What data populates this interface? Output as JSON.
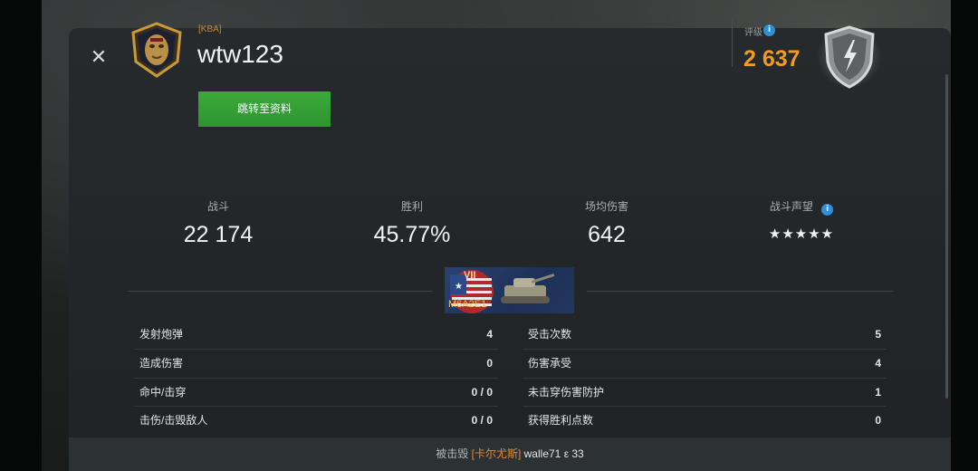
{
  "player": {
    "clan_tag": "[KBA]",
    "name": "wtw123",
    "profile_button": "跳转至资料"
  },
  "rating": {
    "label": "评级",
    "value": "2 637",
    "info_icon": "info-icon"
  },
  "stats": [
    {
      "label": "战斗",
      "value": "22 174"
    },
    {
      "label": "胜利",
      "value": "45.77%"
    },
    {
      "label": "场均伤害",
      "value": "642"
    },
    {
      "label": "战斗声望",
      "value": "★★★★★"
    }
  ],
  "tank": {
    "tier": "VII",
    "name": "M6A2E1",
    "nation": "USA"
  },
  "battle_left": [
    {
      "label": "发射炮弹",
      "value": "4"
    },
    {
      "label": "造成伤害",
      "value": "0"
    },
    {
      "label": "命中/击穿",
      "value": "0 / 0"
    },
    {
      "label": "击伤/击毁敌人",
      "value": "0 / 0"
    }
  ],
  "battle_right": [
    {
      "label": "受击次数",
      "value": "5"
    },
    {
      "label": "伤害承受",
      "value": "4"
    },
    {
      "label": "未击穿伤害防护",
      "value": "1"
    },
    {
      "label": "获得胜利点数",
      "value": "0"
    }
  ],
  "footer": {
    "prefix": "被击毁",
    "killer_clan": "[卡尔尤斯]",
    "killer_name": "walle71",
    "suffix": "ε 33"
  },
  "colors": {
    "accent_green": "#3aa83b",
    "rating_orange": "#f29b1f",
    "clan_orange": "#c98a2b",
    "info_blue": "#2d8fd6"
  }
}
